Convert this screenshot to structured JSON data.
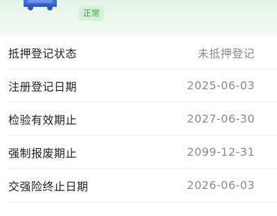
{
  "header": {
    "icon": "car-icon",
    "status_badge": "正常",
    "colors": {
      "accent": "#3d6fd8",
      "badge_text": "#2fa64b",
      "badge_bg": "#d9efdc"
    }
  },
  "rows": [
    {
      "label": "抵押登记状态",
      "value": "未抵押登记"
    },
    {
      "label": "注册登记日期",
      "value": "2025-06-03"
    },
    {
      "label": "检验有效期止",
      "value": "2027-06-30"
    },
    {
      "label": "强制报废期止",
      "value": "2099-12-31"
    },
    {
      "label": "交强险终止日期",
      "value": "2026-06-03"
    }
  ]
}
